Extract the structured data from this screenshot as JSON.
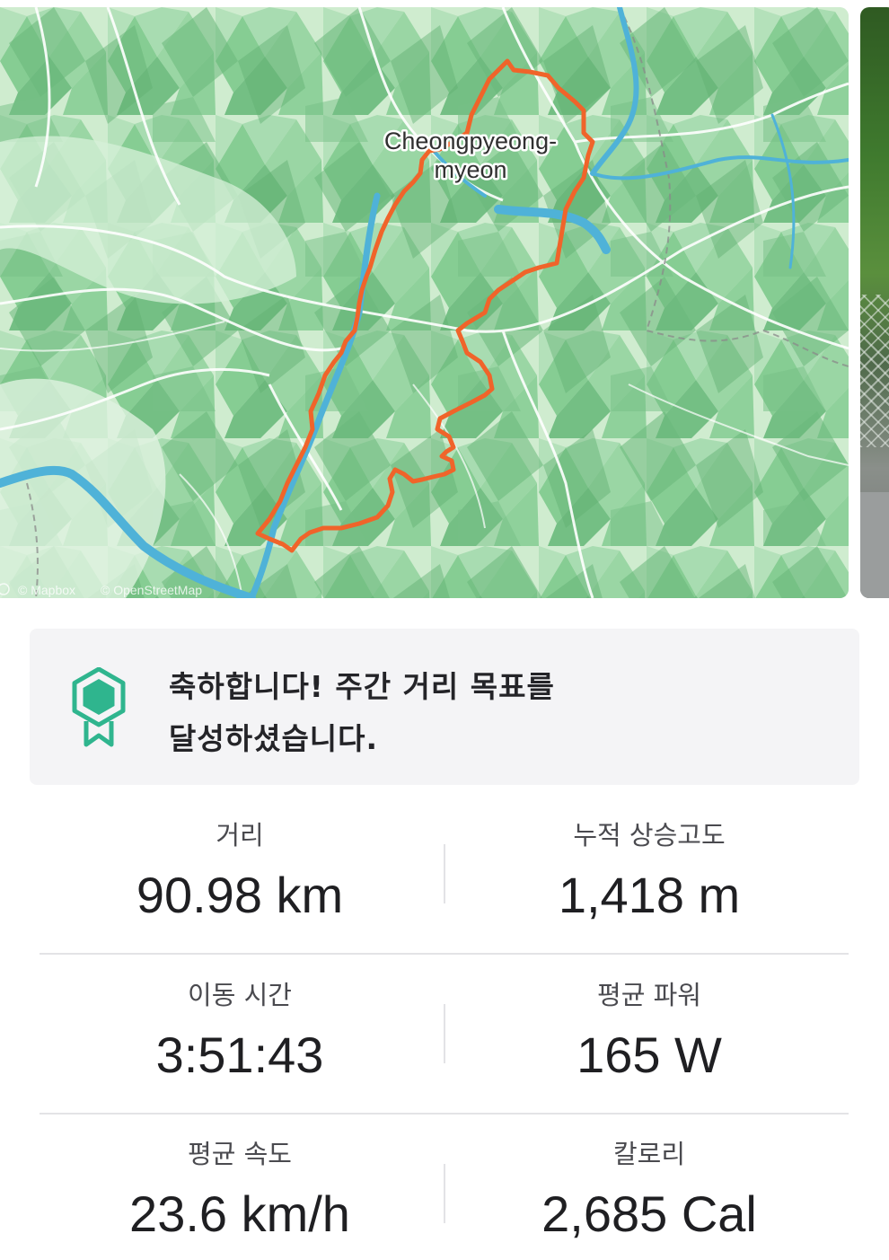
{
  "map": {
    "place_label_line1": "Cheongpyeong-",
    "place_label_line2": "myeon",
    "attribution_mapbox": "© Mapbox",
    "attribution_osm": "© OpenStreetMap",
    "route_color": "#f0642a",
    "land_color": "#d6efd8",
    "forest_color": "#7cc88c",
    "water_color": "#4fb2d8"
  },
  "goal": {
    "line1": "축하합니다! 주간 거리 목표를",
    "line2": "달성하셨습니다.",
    "icon": "achievement-badge-icon",
    "icon_color": "#2fb58e"
  },
  "stats": {
    "distance": {
      "label": "거리",
      "value": "90.98 km"
    },
    "elevation": {
      "label": "누적 상승고도",
      "value": "1,418 m"
    },
    "moving_time": {
      "label": "이동 시간",
      "value": "3:51:43"
    },
    "avg_power": {
      "label": "평균 파워",
      "value": "165 W"
    },
    "avg_speed": {
      "label": "평균 속도",
      "value": "23.6 km/h"
    },
    "calories": {
      "label": "칼로리",
      "value": "2,685 Cal"
    }
  }
}
